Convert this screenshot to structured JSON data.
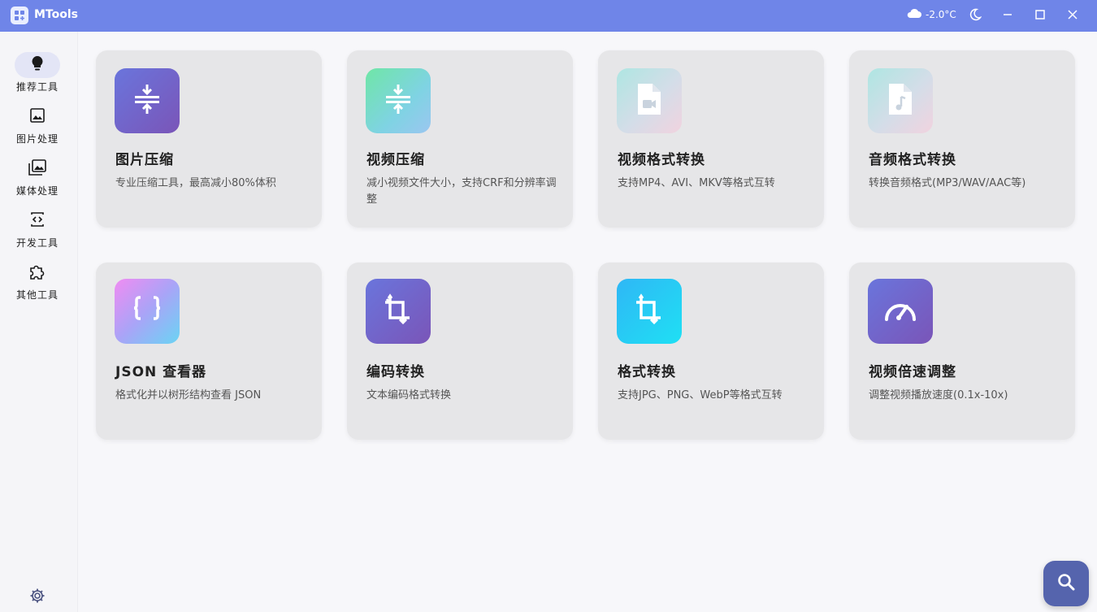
{
  "window": {
    "title": "MTools",
    "weather": "-2.0°C"
  },
  "sidebar": {
    "items": [
      {
        "label": "推荐工具",
        "icon": "lightbulb-icon",
        "active": true
      },
      {
        "label": "图片处理",
        "icon": "image-icon",
        "active": false
      },
      {
        "label": "媒体处理",
        "icon": "photo-library-icon",
        "active": false
      },
      {
        "label": "开发工具",
        "icon": "code-file-icon",
        "active": false
      },
      {
        "label": "其他工具",
        "icon": "puzzle-icon",
        "active": false
      }
    ],
    "settings_icon": "gear-icon"
  },
  "cards": [
    {
      "title": "图片压缩",
      "desc": "专业压缩工具，最高减小80%体积",
      "icon": "compress-icon",
      "color": "#6a75dc"
    },
    {
      "title": "视频压缩",
      "desc": "减小视频文件大小，支持CRF和分辨率调整",
      "icon": "compress-icon",
      "color": "#6fe6a6"
    },
    {
      "title": "视频格式转换",
      "desc": "支持MP4、AVI、MKV等格式互转",
      "icon": "video-file-icon",
      "color": "#aee6e2"
    },
    {
      "title": "音频格式转换",
      "desc": "转换音频格式(MP3/WAV/AAC等)",
      "icon": "audio-file-icon",
      "color": "#aee6e2"
    },
    {
      "title": "JSON 查看器",
      "desc": "格式化并以树形结构查看 JSON",
      "icon": "braces-icon",
      "color": "#f08cf2"
    },
    {
      "title": "编码转换",
      "desc": "文本编码格式转换",
      "icon": "crop-rotate-icon",
      "color": "#6a75dc"
    },
    {
      "title": "格式转换",
      "desc": "支持JPG、PNG、WebP等格式互转",
      "icon": "crop-rotate-icon",
      "color": "#2fb7f5"
    },
    {
      "title": "视频倍速调整",
      "desc": "调整视频播放速度(0.1x-10x)",
      "icon": "speed-gauge-icon",
      "color": "#6a75dc"
    }
  ],
  "search_fab_icon": "search-icon",
  "colors": {
    "titlebar": "#6f85e8",
    "sidebar_active": "#e3e5f6",
    "card_bg": "#e6e6e8",
    "fab": "#5564ad"
  }
}
